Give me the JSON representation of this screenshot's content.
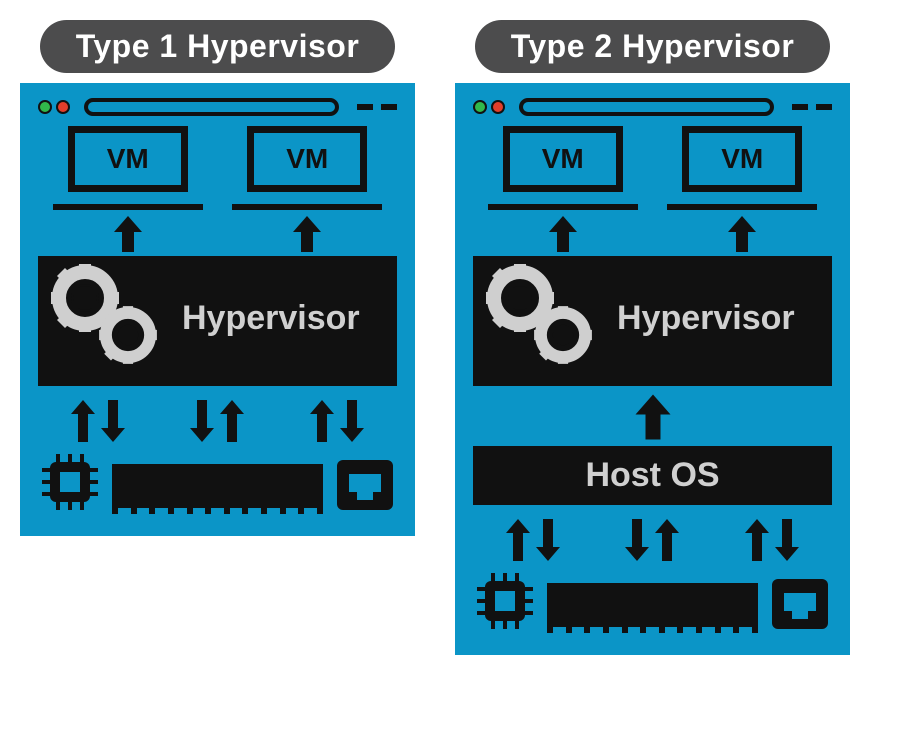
{
  "columns": [
    {
      "title": "Type 1 Hypervisor",
      "vm_label_1": "VM",
      "vm_label_2": "VM",
      "hypervisor_label": "Hypervisor",
      "has_host_os": false,
      "host_os_label": ""
    },
    {
      "title": "Type 2 Hypervisor",
      "vm_label_1": "VM",
      "vm_label_2": "VM",
      "hypervisor_label": "Hypervisor",
      "has_host_os": true,
      "host_os_label": "Host OS"
    }
  ]
}
